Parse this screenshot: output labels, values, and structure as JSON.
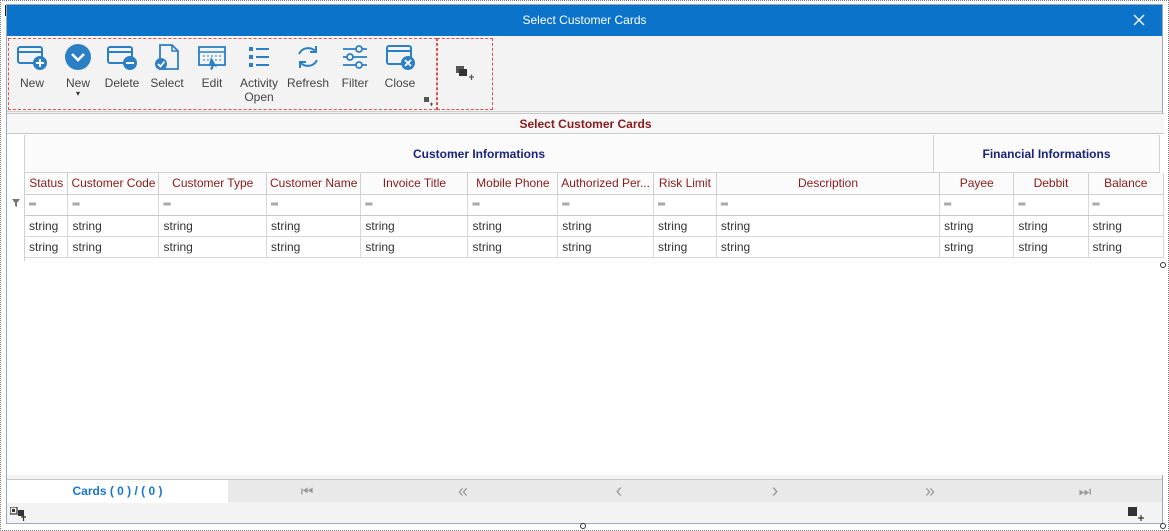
{
  "window": {
    "title": "Select Customer Cards"
  },
  "toolbar": {
    "buttons": [
      {
        "id": "new",
        "label": "New",
        "icon": "add-window-icon"
      },
      {
        "id": "new_dropdown",
        "label": "New",
        "icon": "chevron-down-circle-icon",
        "caret": "▾"
      },
      {
        "id": "delete",
        "label": "Delete",
        "icon": "remove-window-icon"
      },
      {
        "id": "select",
        "label": "Select",
        "icon": "select-document-icon"
      },
      {
        "id": "edit",
        "label": "Edit",
        "icon": "edit-window-icon"
      },
      {
        "id": "activity_open",
        "label_line1": "Activity",
        "label_line2": "Open",
        "icon": "list-icon"
      },
      {
        "id": "refresh",
        "label": "Refresh",
        "icon": "refresh-icon"
      },
      {
        "id": "filter",
        "label": "Filter",
        "icon": "filter-sliders-icon"
      },
      {
        "id": "close",
        "label": "Close",
        "icon": "close-window-icon"
      }
    ]
  },
  "grid": {
    "title": "Select Customer Cards",
    "bands": [
      {
        "label": "Customer Informations"
      },
      {
        "label": "Financial Informations"
      }
    ],
    "columns": [
      "Status",
      "Customer Code",
      "Customer Type",
      "Customer Name",
      "Invoice Title",
      "Mobile Phone",
      "Authorized Per...",
      "Risk Limit",
      "Description",
      "Payee",
      "Debbit",
      "Balance"
    ],
    "filter_symbol": "═",
    "rows": [
      [
        "string",
        "string",
        "string",
        "string",
        "string",
        "string",
        "string",
        "string",
        "string",
        "string",
        "string",
        "string"
      ],
      [
        "string",
        "string",
        "string",
        "string",
        "string",
        "string",
        "string",
        "string",
        "string",
        "string",
        "string",
        "string"
      ]
    ]
  },
  "footer": {
    "cards_count": "Cards ( 0 ) / ( 0 )",
    "nav": {
      "first": "⏮",
      "prev_page": "«",
      "prev": "‹",
      "next": "›",
      "next_page": "»",
      "last": "⏭"
    }
  }
}
